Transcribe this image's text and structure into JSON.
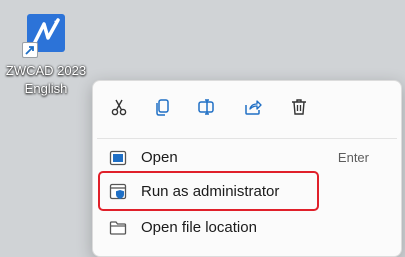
{
  "desktop": {
    "shortcut_label": "ZWCAD 2023 English",
    "shortcut_icon": "zwcad-app-icon"
  },
  "context_menu": {
    "quick_actions": [
      {
        "icon": "cut-icon"
      },
      {
        "icon": "copy-icon"
      },
      {
        "icon": "rename-icon"
      },
      {
        "icon": "share-icon"
      },
      {
        "icon": "delete-icon"
      }
    ],
    "items": [
      {
        "label": "Open",
        "shortcut": "Enter",
        "icon": "open-icon"
      },
      {
        "label": "Run as administrator",
        "shortcut": "",
        "icon": "shield-icon"
      },
      {
        "label": "Open file location",
        "shortcut": "",
        "icon": "folder-icon"
      }
    ]
  },
  "colors": {
    "accent": "#1f6fc5",
    "highlight_border": "#e0202a",
    "app_tile": "#2c73d8"
  }
}
